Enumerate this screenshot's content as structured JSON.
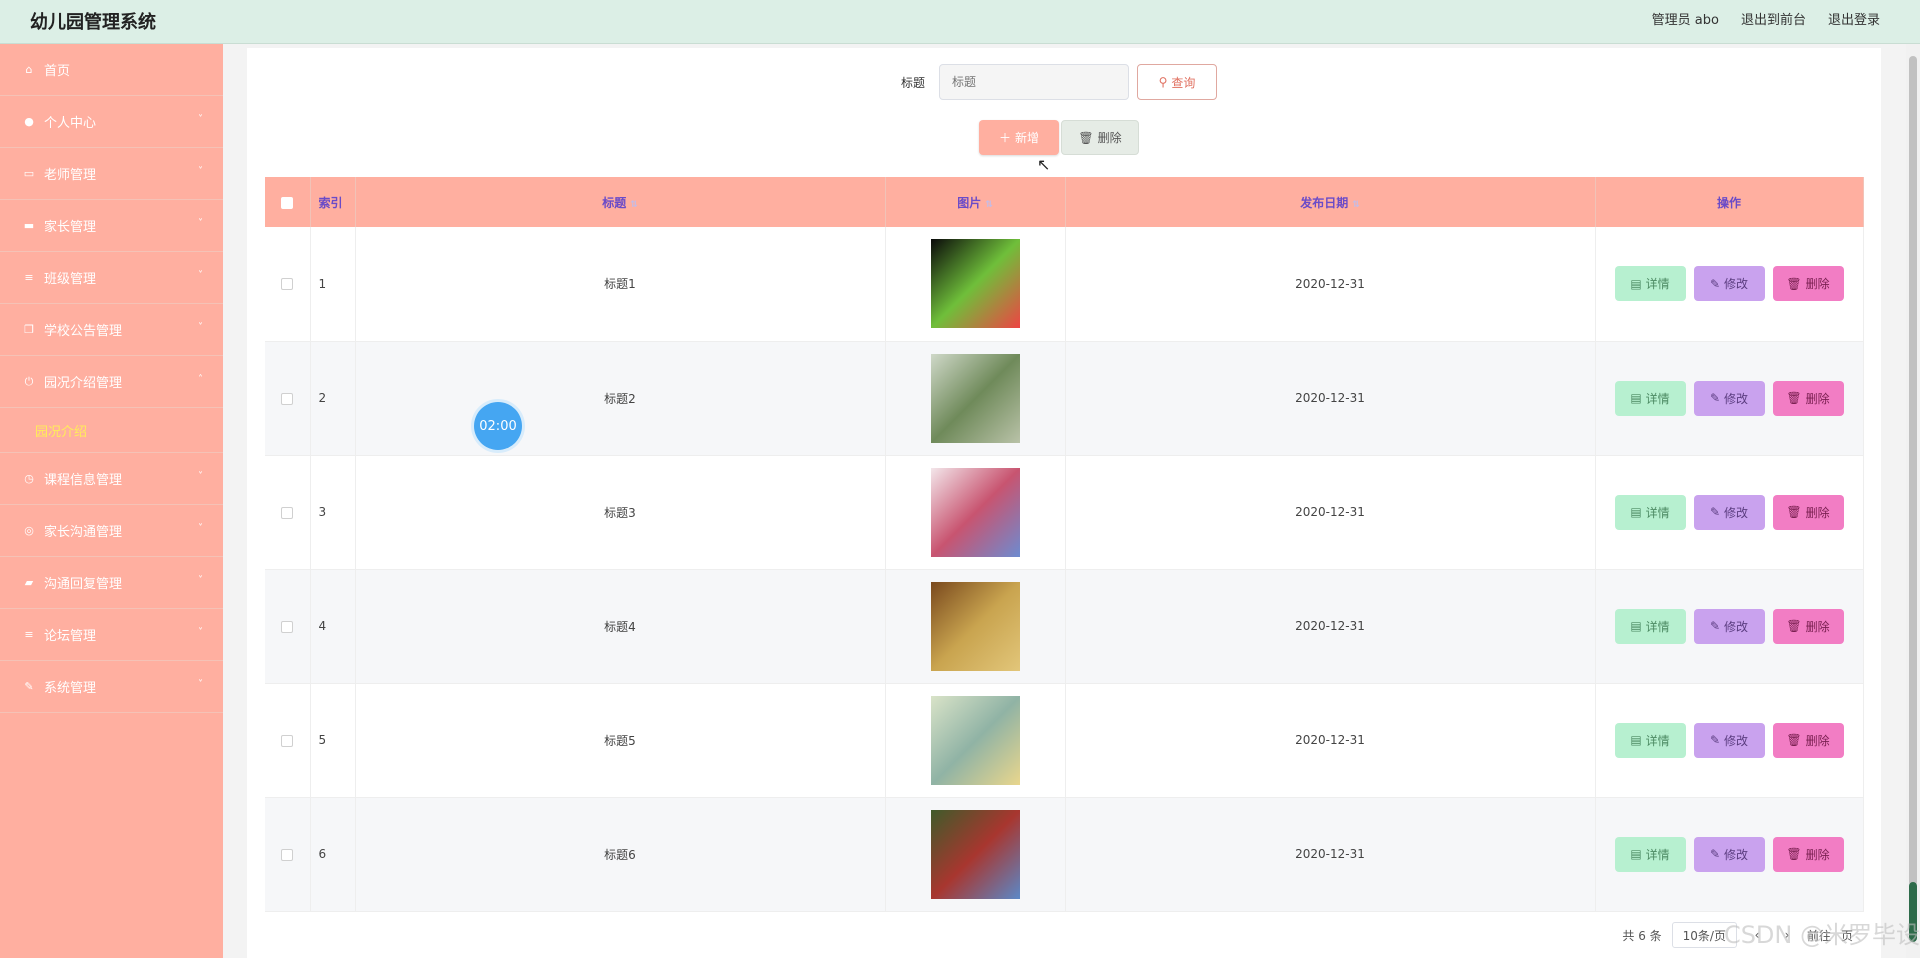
{
  "header": {
    "app_title": "幼儿园管理系统",
    "user_label": "管理员 abo",
    "front_link": "退出到前台",
    "logout_link": "退出登录"
  },
  "sidebar": {
    "items": [
      {
        "label": "首页",
        "icon": "home-icon",
        "glyph": "⌂",
        "arrow": ""
      },
      {
        "label": "个人中心",
        "icon": "user-icon",
        "glyph": "●",
        "arrow": "˅"
      },
      {
        "label": "老师管理",
        "icon": "chat-icon",
        "glyph": "▭",
        "arrow": "˅"
      },
      {
        "label": "家长管理",
        "icon": "monitor-icon",
        "glyph": "▬",
        "arrow": "˅"
      },
      {
        "label": "班级管理",
        "icon": "list-icon",
        "glyph": "≡",
        "arrow": "˅"
      },
      {
        "label": "学校公告管理",
        "icon": "copy-icon",
        "glyph": "❐",
        "arrow": "˅"
      },
      {
        "label": "园况介绍管理",
        "icon": "power-icon",
        "glyph": "⏻",
        "arrow": "˄"
      },
      {
        "label": "课程信息管理",
        "icon": "clock-icon",
        "glyph": "◷",
        "arrow": "˅"
      },
      {
        "label": "家长沟通管理",
        "icon": "globe-icon",
        "glyph": "◎",
        "arrow": "˅"
      },
      {
        "label": "沟通回复管理",
        "icon": "briefcase-icon",
        "glyph": "▰",
        "arrow": "˅"
      },
      {
        "label": "论坛管理",
        "icon": "list-icon",
        "glyph": "≡",
        "arrow": "˅"
      },
      {
        "label": "系统管理",
        "icon": "pen-icon",
        "glyph": "✎",
        "arrow": "˅"
      }
    ],
    "sub_item": "园况介绍"
  },
  "search": {
    "label": "标题",
    "placeholder": "标题",
    "query_label": "查询"
  },
  "actions": {
    "add_label": "新增",
    "delete_label": "删除"
  },
  "table": {
    "headers": {
      "index": "索引",
      "title": "标题",
      "image": "图片",
      "date": "发布日期",
      "ops": "操作"
    },
    "rows": [
      {
        "index": "1",
        "title": "标题1",
        "date": "2020-12-31",
        "img": [
          "#0a0a0a",
          "#6fbf3a",
          "#e44"
        ]
      },
      {
        "index": "2",
        "title": "标题2",
        "date": "2020-12-31",
        "img": [
          "#cfd8c8",
          "#6f8a5a",
          "#b9c2a8"
        ]
      },
      {
        "index": "3",
        "title": "标题3",
        "date": "2020-12-31",
        "img": [
          "#f3e6ea",
          "#c85470",
          "#6d8bd0"
        ]
      },
      {
        "index": "4",
        "title": "标题4",
        "date": "2020-12-31",
        "img": [
          "#7a4a1e",
          "#c9a44f",
          "#e2c67a"
        ]
      },
      {
        "index": "5",
        "title": "标题5",
        "date": "2020-12-31",
        "img": [
          "#d9e3c8",
          "#90b3a5",
          "#e9d68d"
        ]
      },
      {
        "index": "6",
        "title": "标题6",
        "date": "2020-12-31",
        "img": [
          "#3f5b2a",
          "#a8362f",
          "#5b88c7"
        ]
      }
    ],
    "op_detail": "详情",
    "op_edit": "修改",
    "op_delete": "删除"
  },
  "pager": {
    "total": "共 6 条",
    "size": "10条/页",
    "goto": "前往",
    "page_unit": "页"
  },
  "timer": "02:00",
  "watermark": "CSDN @米罗毕设",
  "colors": {
    "header_bg": "#dcefe6",
    "sidebar_bg": "#ffafa0",
    "active_sub": "#ffee58",
    "table_header_text": "#6a4bc8",
    "detail_btn": "#b7f0d0",
    "edit_btn": "#c9a2ee",
    "delete_btn": "#f27dc4"
  }
}
